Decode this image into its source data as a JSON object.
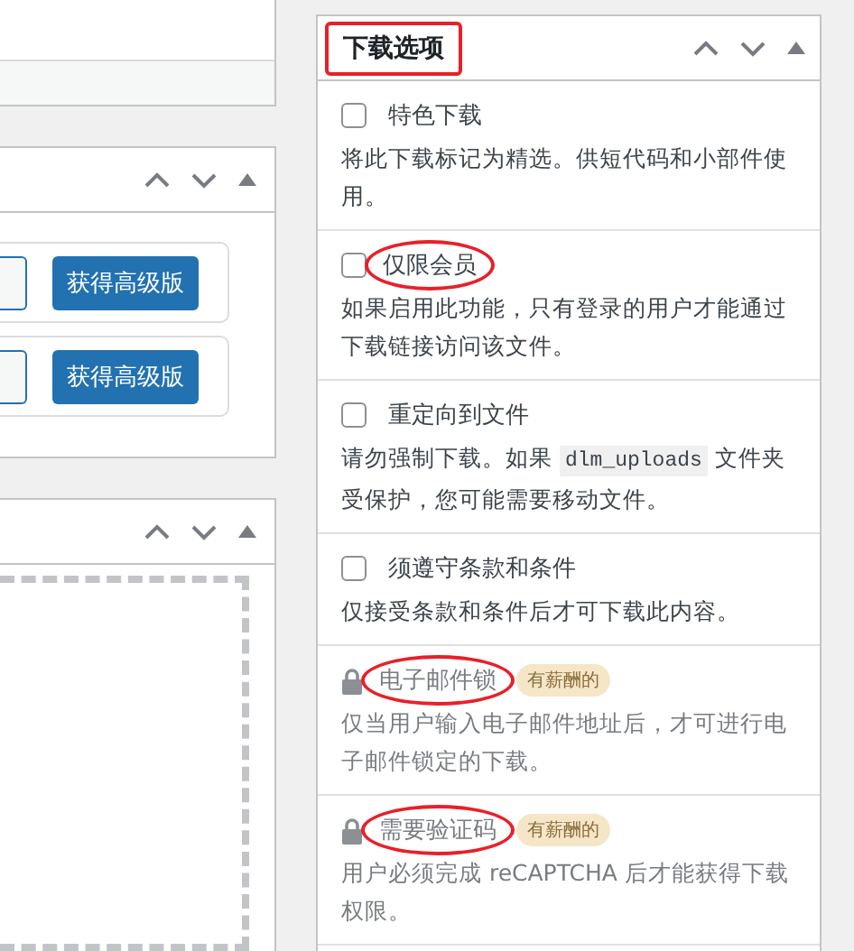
{
  "left_panels": [
    {
      "kind": "blank"
    },
    {
      "kind": "upgrade",
      "cards": [
        {
          "button": "获得高级版"
        },
        {
          "button": "获得高级版"
        }
      ]
    },
    {
      "kind": "dropzone"
    }
  ],
  "download_options": {
    "title": "下载选项",
    "title_circled": true,
    "items": [
      {
        "kind": "checkbox",
        "label": "特色下载",
        "checked": false,
        "circled": false,
        "description": "将此下载标记为精选。供短代码和小部件使用。"
      },
      {
        "kind": "checkbox",
        "label": "仅限会员",
        "checked": false,
        "circled": true,
        "description": "如果启用此功能，只有登录的用户才能通过下载链接访问该文件。"
      },
      {
        "kind": "checkbox",
        "label": "重定向到文件",
        "checked": false,
        "circled": false,
        "description": [
          {
            "text": "请勿强制下载。如果 ",
            "kind": "plain"
          },
          {
            "text": "dlm_uploads",
            "kind": "code"
          },
          {
            "text": " 文件夹受保护，您可能需要移动文件。",
            "kind": "plain"
          }
        ]
      },
      {
        "kind": "checkbox",
        "label": "须遵守条款和条件",
        "checked": false,
        "circled": false,
        "description": "仅接受条款和条件后才可下载此内容。"
      },
      {
        "kind": "locked",
        "label": "电子邮件锁",
        "badge": "有薪酬的",
        "circled": true,
        "description": "仅当用户输入电子邮件地址后，才可进行电子邮件锁定的下载。"
      },
      {
        "kind": "locked",
        "label": "需要验证码",
        "badge": "有薪酬的",
        "circled": true,
        "description": "用户必须完成 reCAPTCHA 后才能获得下载权限。"
      }
    ]
  }
}
